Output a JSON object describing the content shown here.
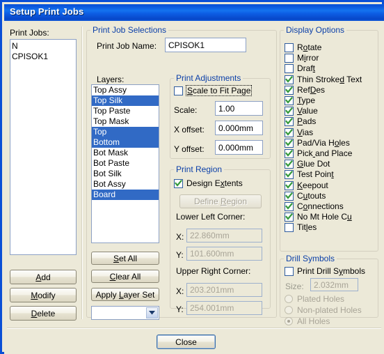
{
  "window": {
    "title": "Setup Print Jobs",
    "titlebar_color": "#0a52d8",
    "face_color": "#ece9d8",
    "group_title_color": "#0b3fa8",
    "selection_color": "#316ac5"
  },
  "print_jobs": {
    "label": "Print Jobs:",
    "items": [
      "N",
      "CPISOK1"
    ],
    "buttons": {
      "add": "Add",
      "modify": "Modify",
      "delete": "Delete"
    }
  },
  "print_job_selections": {
    "title": "Print Job Selections",
    "name_label": "Print Job Name:",
    "name_value": "CPISOK1",
    "layers_label": "Layers:",
    "layers": [
      {
        "label": "Top Assy",
        "selected": false
      },
      {
        "label": "Top Silk",
        "selected": true
      },
      {
        "label": "Top Paste",
        "selected": false
      },
      {
        "label": "Top Mask",
        "selected": false
      },
      {
        "label": "Top",
        "selected": true
      },
      {
        "label": "Bottom",
        "selected": true
      },
      {
        "label": "Bot Mask",
        "selected": false
      },
      {
        "label": "Bot Paste",
        "selected": false
      },
      {
        "label": "Bot Silk",
        "selected": false
      },
      {
        "label": "Bot Assy",
        "selected": false
      },
      {
        "label": "Board",
        "selected": true
      }
    ],
    "layer_buttons": {
      "set_all": "Set All",
      "clear_all": "Clear All",
      "apply_layer_set": "Apply Layer Set"
    },
    "layer_set_combo_value": ""
  },
  "print_adjustments": {
    "title": "Print Adjustments",
    "scale_to_fit": {
      "label": "Scale to Fit Page",
      "checked": false,
      "focused": true
    },
    "scale_label": "Scale:",
    "scale_value": "1.00",
    "x_offset_label": "X offset:",
    "x_offset_value": "0.000mm",
    "y_offset_label": "Y offset:",
    "y_offset_value": "0.000mm"
  },
  "print_region": {
    "title": "Print Region",
    "design_extents": {
      "label": "Design Extents",
      "checked": true
    },
    "define_region_button": "Define Region",
    "lower_left_label": "Lower Left Corner:",
    "ll_x_label": "X:",
    "ll_x_value": "22.860mm",
    "ll_y_label": "Y:",
    "ll_y_value": "101.600mm",
    "upper_right_label": "Upper Right Corner:",
    "ur_x_label": "X:",
    "ur_x_value": "203.201mm",
    "ur_y_label": "Y:",
    "ur_y_value": "254.001mm"
  },
  "display_options": {
    "title": "Display Options",
    "items": [
      {
        "label": "Rotate",
        "checked": false
      },
      {
        "label": "Mirror",
        "checked": false
      },
      {
        "label": "Draft",
        "checked": false
      },
      {
        "label": "Thin Stroked Text",
        "checked": true
      },
      {
        "label": "RefDes",
        "checked": true
      },
      {
        "label": "Type",
        "checked": true
      },
      {
        "label": "Value",
        "checked": true
      },
      {
        "label": "Pads",
        "checked": true
      },
      {
        "label": "Vias",
        "checked": true
      },
      {
        "label": "Pad/Via Holes",
        "checked": true
      },
      {
        "label": "Pick and Place",
        "checked": true
      },
      {
        "label": "Glue Dot",
        "checked": true
      },
      {
        "label": "Test Point",
        "checked": true
      },
      {
        "label": "Keepout",
        "checked": true
      },
      {
        "label": "Cutouts",
        "checked": true
      },
      {
        "label": "Connections",
        "checked": true
      },
      {
        "label": "No Mt Hole Cu",
        "checked": true
      },
      {
        "label": "Titles",
        "checked": false
      }
    ]
  },
  "drill_symbols": {
    "title": "Drill Symbols",
    "print_drill_symbols": {
      "label": "Print Drill Symbols",
      "checked": false
    },
    "size_label": "Size:",
    "size_value": "2.032mm",
    "options": [
      {
        "label": "Plated Holes",
        "selected": false
      },
      {
        "label": "Non-plated Holes",
        "selected": false
      },
      {
        "label": "All Holes",
        "selected": true
      }
    ]
  },
  "footer": {
    "close_button": "Close"
  }
}
